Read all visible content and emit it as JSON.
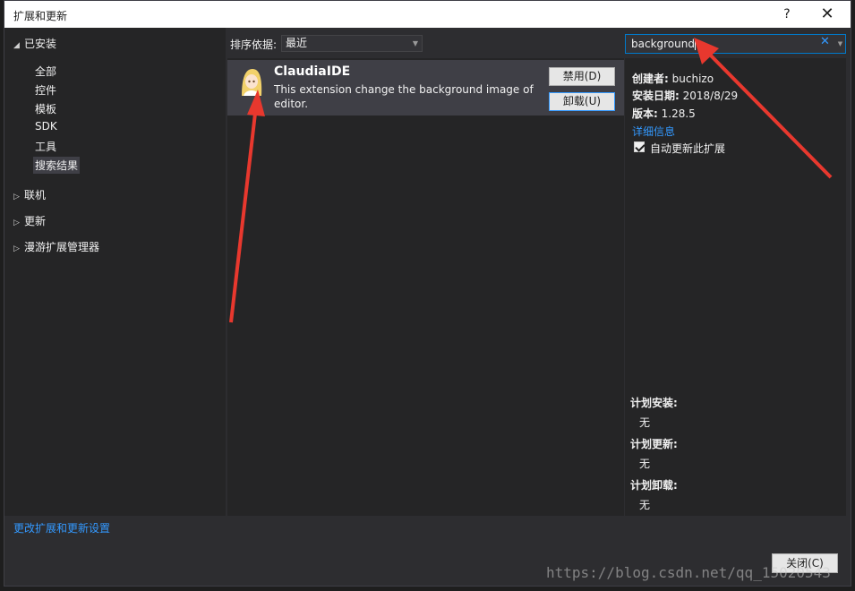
{
  "window": {
    "title": "扩展和更新",
    "help_glyph": "?",
    "close_glyph": "✕"
  },
  "nav": {
    "installed": "已安装",
    "installed_items": [
      "全部",
      "控件",
      "模板",
      "SDK",
      "工具",
      "搜索结果"
    ],
    "online": "联机",
    "updates": "更新",
    "roaming": "漫游扩展管理器"
  },
  "sort": {
    "label": "排序依据:",
    "value": "最近"
  },
  "search": {
    "value": "background",
    "clear_glyph": "✕"
  },
  "extension": {
    "name": "ClaudiaIDE",
    "description": "This extension change the background image of editor.",
    "disable_label": "禁用(D)",
    "uninstall_label": "卸载(U)"
  },
  "details": {
    "creator_label": "创建者:",
    "creator": "buchizo",
    "install_date_label": "安装日期:",
    "install_date": "2018/8/29",
    "version_label": "版本:",
    "version": "1.28.5",
    "more_info": "详细信息",
    "auto_update": "自动更新此扩展",
    "planned_install_label": "计划安装:",
    "planned_install": "无",
    "planned_update_label": "计划更新:",
    "planned_update": "无",
    "planned_uninstall_label": "计划卸载:",
    "planned_uninstall": "无"
  },
  "footer": {
    "settings_link": "更改扩展和更新设置",
    "close_label": "关闭(C)",
    "watermark": "https://blog.csdn.net/qq_15020543"
  },
  "colors": {
    "accent": "#007acc",
    "link": "#3399ff",
    "annotation": "#e8382e"
  }
}
